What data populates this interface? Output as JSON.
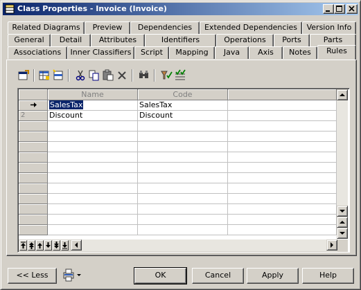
{
  "window": {
    "title": "Class Properties - Invoice (Invoice)",
    "buttons": [
      "minimize",
      "maximize",
      "close"
    ]
  },
  "tabs": {
    "row1": [
      "Related Diagrams",
      "Preview",
      "Dependencies",
      "Extended Dependencies",
      "Version Info"
    ],
    "row2": [
      "General",
      "Detail",
      "Attributes",
      "Identifiers",
      "Operations",
      "Ports",
      "Parts"
    ],
    "row3": [
      "Associations",
      "Inner Classifiers",
      "Script",
      "Mapping",
      "Java",
      "Axis",
      "Notes",
      "Rules"
    ],
    "active": "Rules"
  },
  "toolbar": {
    "icons": [
      "properties-icon",
      "add-rows-icon",
      "insert-row-icon",
      "cut-icon",
      "copy-icon",
      "paste-icon",
      "delete-icon",
      "find-icon",
      "filter-icon",
      "customize-columns-icon"
    ]
  },
  "grid": {
    "columns": [
      "Name",
      "Code"
    ],
    "rows": [
      {
        "num": "",
        "name": "SalesTax",
        "code": "SalesTax",
        "current": true
      },
      {
        "num": "2",
        "name": "Discount",
        "code": "Discount",
        "current": false
      }
    ]
  },
  "footer": {
    "less_label": "<< Less",
    "ok_label": "OK",
    "cancel_label": "Cancel",
    "apply_label": "Apply",
    "help_label": "Help"
  }
}
